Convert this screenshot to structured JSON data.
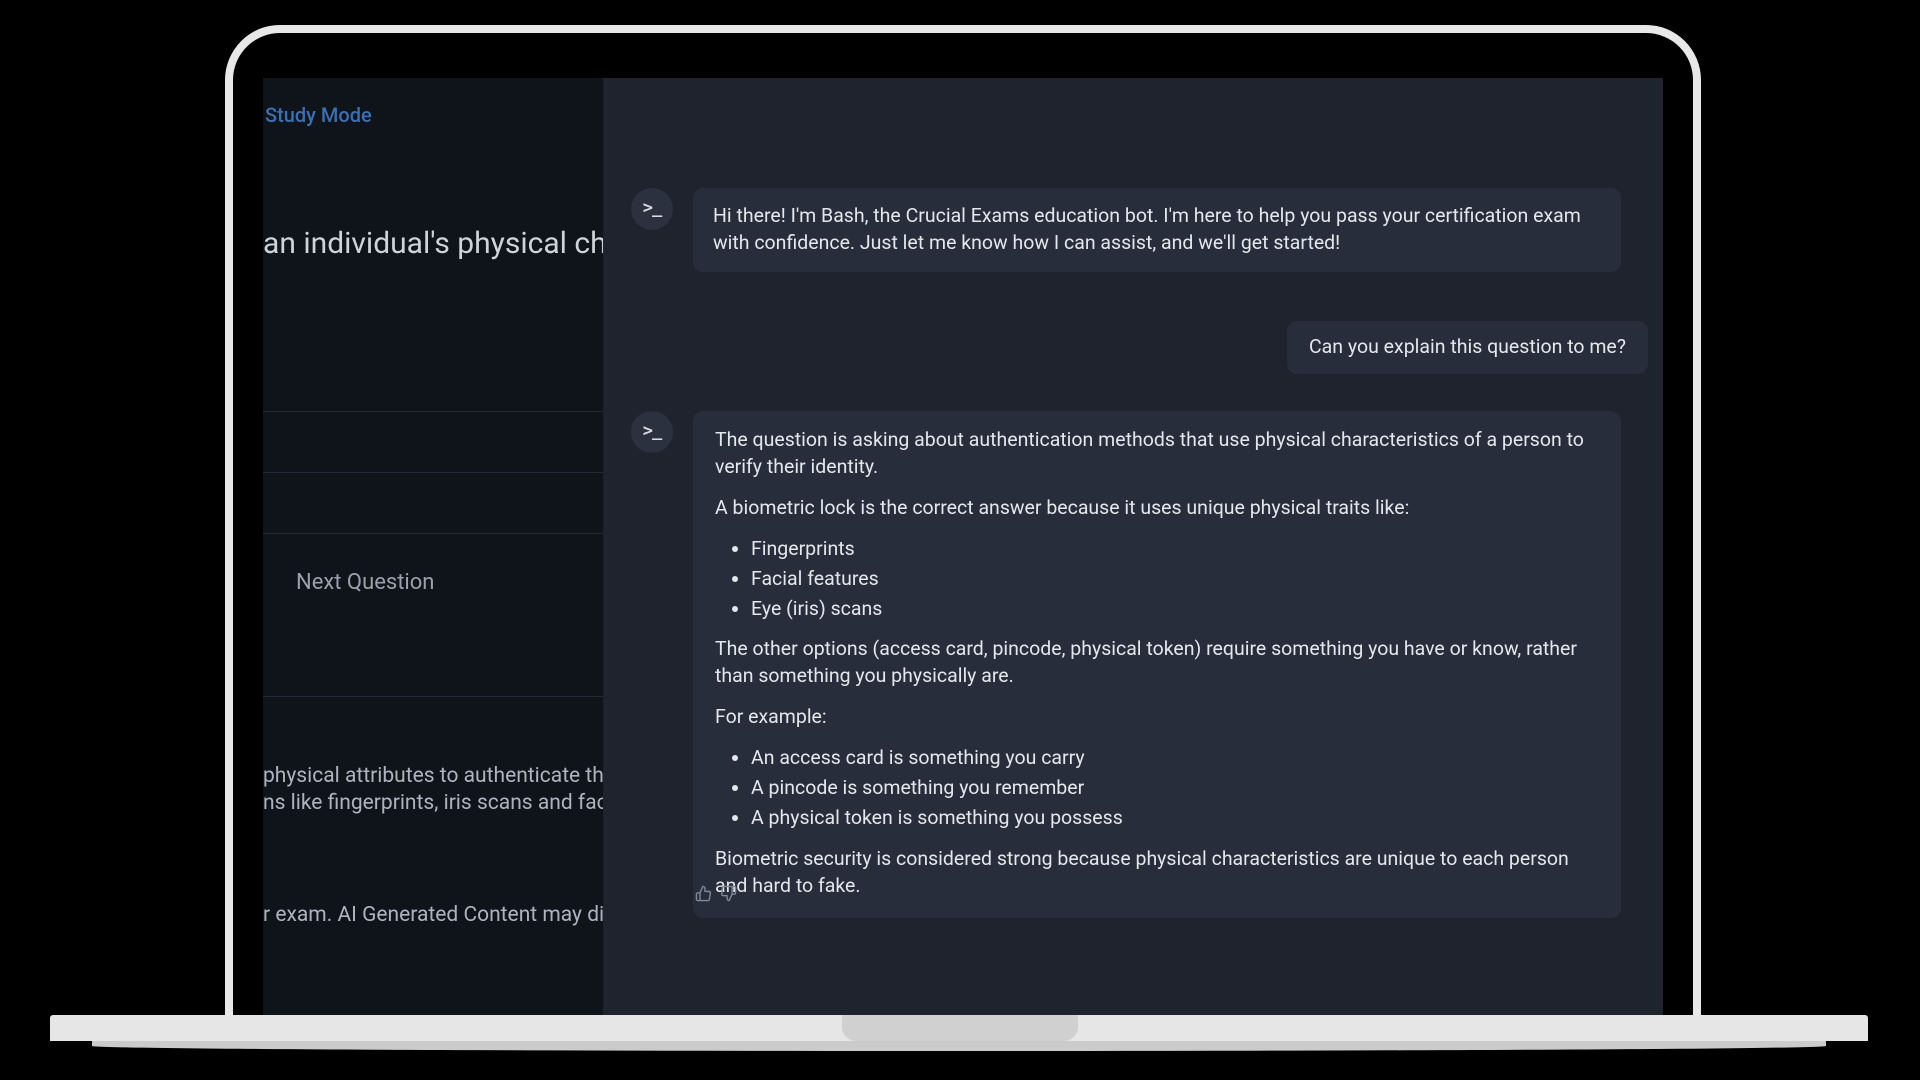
{
  "left": {
    "mode_label": "Study Mode",
    "question_fragment": "an individual's physical cha",
    "next_question": "Next Question",
    "help_line1": "physical attributes to authenticate them.",
    "help_line2": "ns like fingerprints, iris scans and facial r",
    "ai_line": "r exam. AI Generated Content may displ"
  },
  "chat": {
    "bot_intro": "Hi there! I'm Bash, the Crucial Exams education bot. I'm here to help you pass your certification exam with confidence. Just let me know how I can assist, and we'll get started!",
    "user_msg": "Can you explain this question to me?",
    "bot_answer": {
      "p1": "The question is asking about authentication methods that use physical characteristics of a person to verify their identity.",
      "p2": "A biometric lock is the correct answer because it uses unique physical traits like:",
      "list1": [
        "Fingerprints",
        "Facial features",
        "Eye (iris) scans"
      ],
      "p3": "The other options (access card, pincode, physical token) require something you have or know, rather than something you physically are.",
      "p4": "For example:",
      "list2": [
        "An access card is something you carry",
        "A pincode is something you remember",
        "A physical token is something you possess"
      ],
      "p5": "Biometric security is considered strong because physical characteristics are unique to each person and hard to fake."
    }
  }
}
